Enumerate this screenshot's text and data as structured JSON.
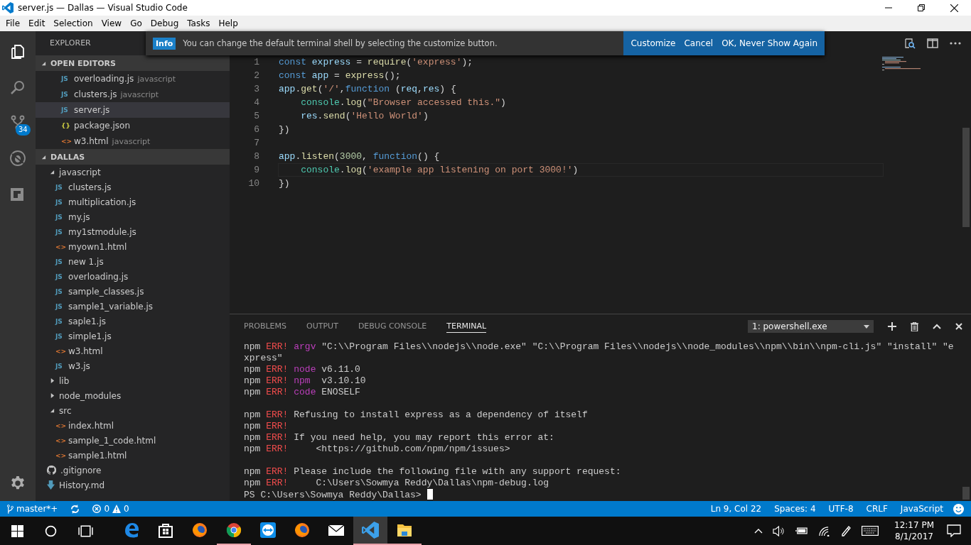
{
  "window": {
    "title": "server.js — Dallas — Visual Studio Code"
  },
  "menu": [
    "File",
    "Edit",
    "Selection",
    "View",
    "Go",
    "Debug",
    "Tasks",
    "Help"
  ],
  "activity_bar": {
    "items": [
      {
        "kind": "files",
        "selected": true
      },
      {
        "kind": "search",
        "selected": false
      },
      {
        "kind": "git",
        "selected": false,
        "badge": "34"
      },
      {
        "kind": "debug",
        "selected": false
      },
      {
        "kind": "extensions",
        "selected": false
      }
    ]
  },
  "explorer": {
    "title": "EXPLORER",
    "open_editors": {
      "label": "OPEN EDITORS",
      "expanded": true,
      "items": [
        {
          "kind": "js",
          "glyph": "JS",
          "name": "overloading.js",
          "hint": "javascript",
          "selected": false
        },
        {
          "kind": "js",
          "glyph": "JS",
          "name": "clusters.js",
          "hint": "javascript",
          "selected": false
        },
        {
          "kind": "js",
          "glyph": "JS",
          "name": "server.js",
          "selected": true
        },
        {
          "kind": "json",
          "glyph": "{}",
          "name": "package.json",
          "selected": false
        },
        {
          "kind": "html",
          "glyph": "<>",
          "name": "w3.html",
          "hint": "javascript",
          "selected": false
        }
      ]
    },
    "folder": {
      "label": "DALLAS",
      "expanded": true,
      "children": [
        {
          "kind": "folder",
          "name": "javascript",
          "expanded": true,
          "children": [
            {
              "kind": "js",
              "glyph": "JS",
              "name": "clusters.js"
            },
            {
              "kind": "js",
              "glyph": "JS",
              "name": "multiplication.js"
            },
            {
              "kind": "js",
              "glyph": "JS",
              "name": "my.js"
            },
            {
              "kind": "js",
              "glyph": "JS",
              "name": "my1stmodule.js"
            },
            {
              "kind": "html",
              "glyph": "<>",
              "name": "myown1.html"
            },
            {
              "kind": "js",
              "glyph": "JS",
              "name": "new 1.js"
            },
            {
              "kind": "js",
              "glyph": "JS",
              "name": "overloading.js"
            },
            {
              "kind": "js",
              "glyph": "JS",
              "name": "sample_classes.js"
            },
            {
              "kind": "js",
              "glyph": "JS",
              "name": "sample1_variable.js"
            },
            {
              "kind": "js",
              "glyph": "JS",
              "name": "saple1.js"
            },
            {
              "kind": "js",
              "glyph": "JS",
              "name": "simple1.js"
            },
            {
              "kind": "html",
              "glyph": "<>",
              "name": "w3.html"
            },
            {
              "kind": "js",
              "glyph": "JS",
              "name": "w3.js"
            }
          ]
        },
        {
          "kind": "folder",
          "name": "lib",
          "expanded": false
        },
        {
          "kind": "folder",
          "name": "node_modules",
          "expanded": false
        },
        {
          "kind": "folder",
          "name": "src",
          "expanded": true,
          "children": [
            {
              "kind": "html",
              "glyph": "<>",
              "name": "index.html"
            },
            {
              "kind": "html",
              "glyph": "<>",
              "name": "sample_1_code.html"
            },
            {
              "kind": "html",
              "glyph": "<>",
              "name": "sample1.html"
            }
          ]
        },
        {
          "kind": "git",
          "name": ".gitignore"
        },
        {
          "kind": "md",
          "name": "History.md"
        }
      ]
    }
  },
  "notification": {
    "tag": "Info",
    "message": "You can change the default terminal shell by selecting the customize button.",
    "buttons": [
      "Customize",
      "Cancel",
      "OK, Never Show Again"
    ]
  },
  "editor": {
    "lines": [
      {
        "number": "1",
        "current": false,
        "tokens": [
          {
            "kind": "keyword",
            "text": "const"
          },
          {
            "kind": "variable",
            "text": " express"
          },
          {
            "kind": "plain",
            "text": " = "
          },
          {
            "kind": "function",
            "text": "require"
          },
          {
            "kind": "plain",
            "text": "("
          },
          {
            "kind": "string",
            "text": "'express'"
          },
          {
            "kind": "plain",
            "text": ");"
          }
        ]
      },
      {
        "number": "2",
        "current": false,
        "tokens": [
          {
            "kind": "keyword",
            "text": "const"
          },
          {
            "kind": "variable",
            "text": " app"
          },
          {
            "kind": "plain",
            "text": " = "
          },
          {
            "kind": "function",
            "text": "express"
          },
          {
            "kind": "plain",
            "text": "();"
          }
        ]
      },
      {
        "number": "3",
        "current": false,
        "tokens": [
          {
            "kind": "variable",
            "text": "app"
          },
          {
            "kind": "plain",
            "text": "."
          },
          {
            "kind": "function",
            "text": "get"
          },
          {
            "kind": "plain",
            "text": "("
          },
          {
            "kind": "string",
            "text": "'/'"
          },
          {
            "kind": "plain",
            "text": ","
          },
          {
            "kind": "keyword",
            "text": "function"
          },
          {
            "kind": "plain",
            "text": " ("
          },
          {
            "kind": "variable",
            "text": "req"
          },
          {
            "kind": "plain",
            "text": ","
          },
          {
            "kind": "variable",
            "text": "res"
          },
          {
            "kind": "plain",
            "text": ") {"
          }
        ]
      },
      {
        "number": "4",
        "current": false,
        "tokens": [
          {
            "kind": "class",
            "text": "    console"
          },
          {
            "kind": "plain",
            "text": "."
          },
          {
            "kind": "function",
            "text": "log"
          },
          {
            "kind": "plain",
            "text": "("
          },
          {
            "kind": "string",
            "text": "\"Browser accessed this.\""
          },
          {
            "kind": "plain",
            "text": ")"
          }
        ]
      },
      {
        "number": "5",
        "current": false,
        "tokens": [
          {
            "kind": "variable",
            "text": "    res"
          },
          {
            "kind": "plain",
            "text": "."
          },
          {
            "kind": "function",
            "text": "send"
          },
          {
            "kind": "plain",
            "text": "("
          },
          {
            "kind": "string",
            "text": "'Hello World'"
          },
          {
            "kind": "plain",
            "text": ")"
          }
        ]
      },
      {
        "number": "6",
        "current": false,
        "tokens": [
          {
            "kind": "plain",
            "text": "})"
          }
        ]
      },
      {
        "number": "7",
        "current": false
      },
      {
        "number": "8",
        "current": false,
        "tokens": [
          {
            "kind": "variable",
            "text": "app"
          },
          {
            "kind": "plain",
            "text": "."
          },
          {
            "kind": "function",
            "text": "listen"
          },
          {
            "kind": "plain",
            "text": "("
          },
          {
            "kind": "number",
            "text": "3000"
          },
          {
            "kind": "plain",
            "text": ", "
          },
          {
            "kind": "keyword",
            "text": "function"
          },
          {
            "kind": "plain",
            "text": "() {"
          }
        ]
      },
      {
        "number": "9",
        "current": true,
        "tokens": [
          {
            "kind": "class",
            "text": "    console"
          },
          {
            "kind": "plain",
            "text": "."
          },
          {
            "kind": "function",
            "text": "log"
          },
          {
            "kind": "plain",
            "text": "("
          },
          {
            "kind": "string",
            "text": "'example app listening on port 3000!'"
          },
          {
            "kind": "plain",
            "text": ")"
          }
        ]
      },
      {
        "number": "10",
        "current": false,
        "tokens": [
          {
            "kind": "plain",
            "text": "})"
          }
        ]
      }
    ]
  },
  "panel": {
    "tabs": [
      {
        "label": "PROBLEMS",
        "selected": false
      },
      {
        "label": "OUTPUT",
        "selected": false
      },
      {
        "label": "DEBUG CONSOLE",
        "selected": false
      },
      {
        "label": "TERMINAL",
        "selected": true
      }
    ],
    "terminal_select": "1: powershell.exe",
    "terminal": [
      {
        "kind": "output",
        "segments": [
          {
            "kind": "plain",
            "text": "npm "
          },
          {
            "kind": "error",
            "text": "ERR!"
          },
          {
            "kind": "keyword",
            "text": " argv"
          },
          {
            "kind": "plain",
            "text": " \"C:\\\\Program Files\\\\nodejs\\\\node.exe\" \"C:\\\\Program Files\\\\nodejs\\\\node_modules\\\\npm\\\\bin\\\\npm-cli.js\" \"install\" \"express\""
          }
        ]
      },
      {
        "kind": "output",
        "segments": [
          {
            "kind": "plain",
            "text": "npm "
          },
          {
            "kind": "error",
            "text": "ERR!"
          },
          {
            "kind": "keyword",
            "text": " node"
          },
          {
            "kind": "plain",
            "text": " v6.11.0"
          }
        ]
      },
      {
        "kind": "output",
        "segments": [
          {
            "kind": "plain",
            "text": "npm "
          },
          {
            "kind": "error",
            "text": "ERR!"
          },
          {
            "kind": "keyword",
            "text": " npm"
          },
          {
            "kind": "plain",
            "text": "  v3.10.10"
          }
        ]
      },
      {
        "kind": "output",
        "segments": [
          {
            "kind": "plain",
            "text": "npm "
          },
          {
            "kind": "error",
            "text": "ERR!"
          },
          {
            "kind": "keyword",
            "text": " code"
          },
          {
            "kind": "plain",
            "text": " ENOSELF"
          }
        ]
      },
      {
        "kind": "blank"
      },
      {
        "kind": "output",
        "segments": [
          {
            "kind": "plain",
            "text": "npm "
          },
          {
            "kind": "error",
            "text": "ERR!"
          },
          {
            "kind": "plain",
            "text": " Refusing to install express as a dependency of itself"
          }
        ]
      },
      {
        "kind": "output",
        "segments": [
          {
            "kind": "plain",
            "text": "npm "
          },
          {
            "kind": "error",
            "text": "ERR!"
          }
        ]
      },
      {
        "kind": "output",
        "segments": [
          {
            "kind": "plain",
            "text": "npm "
          },
          {
            "kind": "error",
            "text": "ERR!"
          },
          {
            "kind": "plain",
            "text": " If you need help, you may report this error at:"
          }
        ]
      },
      {
        "kind": "output",
        "segments": [
          {
            "kind": "plain",
            "text": "npm "
          },
          {
            "kind": "error",
            "text": "ERR!"
          },
          {
            "kind": "plain",
            "text": "     <https://github.com/npm/npm/issues>"
          }
        ]
      },
      {
        "kind": "blank"
      },
      {
        "kind": "output",
        "segments": [
          {
            "kind": "plain",
            "text": "npm "
          },
          {
            "kind": "error",
            "text": "ERR!"
          },
          {
            "kind": "plain",
            "text": " Please include the following file with any support request:"
          }
        ]
      },
      {
        "kind": "output",
        "segments": [
          {
            "kind": "plain",
            "text": "npm "
          },
          {
            "kind": "error",
            "text": "ERR!"
          },
          {
            "kind": "plain",
            "text": "     C:\\Users\\Sowmya Reddy\\Dallas\\npm-debug.log"
          }
        ]
      },
      {
        "kind": "prompt",
        "segments": [
          {
            "kind": "plain",
            "text": "PS C:\\Users\\Sowmya Reddy\\Dallas>"
          }
        ]
      }
    ]
  },
  "status_bar": {
    "branch": "master*+",
    "errors": "0",
    "warnings": "0",
    "right": [
      "Ln 9, Col 22",
      "Spaces: 4",
      "UTF-8",
      "CRLF",
      "JavaScript"
    ]
  },
  "taskbar": {
    "apps": [
      {
        "kind": "edge",
        "running": false,
        "selected": false
      },
      {
        "kind": "store",
        "running": false,
        "selected": false
      },
      {
        "kind": "firefox",
        "running": false,
        "selected": false
      },
      {
        "kind": "chrome",
        "running": true,
        "selected": false
      },
      {
        "kind": "teamviewer",
        "running": false,
        "selected": false
      },
      {
        "kind": "firefox",
        "running": false,
        "selected": false
      },
      {
        "kind": "mail",
        "running": false,
        "selected": false
      },
      {
        "kind": "vscode",
        "running": true,
        "selected": true
      },
      {
        "kind": "explorer",
        "running": true,
        "selected": false
      }
    ],
    "time": "12:17 PM",
    "date": "8/1/2017"
  }
}
